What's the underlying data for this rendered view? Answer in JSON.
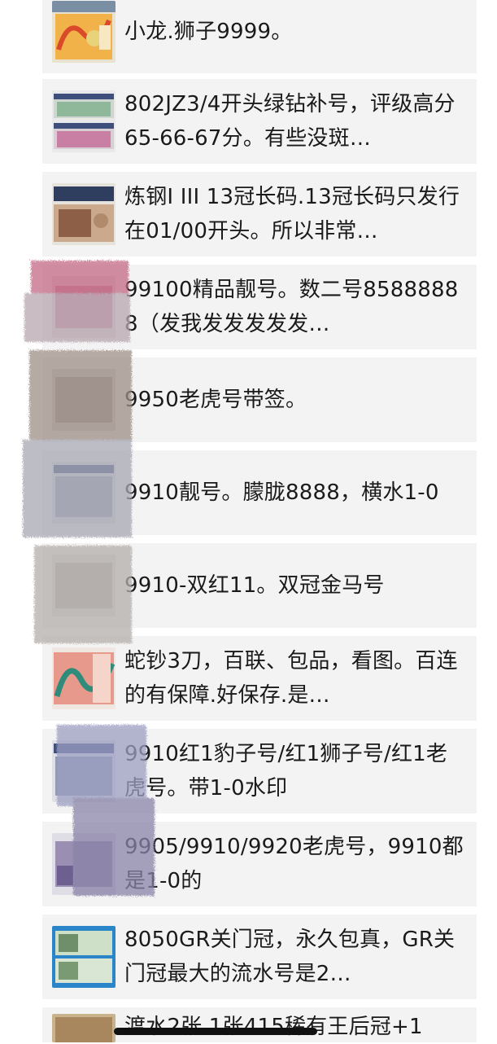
{
  "posts": [
    {
      "text": "小龙.狮子9999。",
      "thumb": "dragon-banknote"
    },
    {
      "text": "802JZ3/4开头绿钻补号，评级高分65-66-67分。有些没斑…",
      "thumb": "graded-banknotes"
    },
    {
      "text": "炼钢I III 13冠长码.13冠长码只发行在01/00开头。所以非常…",
      "thumb": "steelworker-banknote"
    },
    {
      "text": "99100精品靓号。数二号85888888（发我发发发发发…",
      "thumb": "banknote"
    },
    {
      "text": "9950老虎号带签。",
      "thumb": "banknote"
    },
    {
      "text": "9910靓号。朦胧8888，横水1-0",
      "thumb": "graded-banknote"
    },
    {
      "text": "9910-双红11。双冠金马号",
      "thumb": "banknote"
    },
    {
      "text": "蛇钞3刀，百联、包品，看图。百连的有保障.好保存.是…",
      "thumb": "snake-commemorative-notes"
    },
    {
      "text": "9910红1豹子号/红1狮子号/红1老虎号。带1-0水印",
      "thumb": "graded-banknote"
    },
    {
      "text": "9905/9910/9920老虎号，9910都是1-0的",
      "thumb": "five-yuan-banknote"
    },
    {
      "text": "8050GR关门冠，永久包真，GR关门冠最大的流水号是2…",
      "thumb": "fifty-yuan-banknotes"
    },
    {
      "text": "渡水2张.1张415稀有王后冠+1",
      "thumb": "five-yuan-banknote"
    }
  ]
}
